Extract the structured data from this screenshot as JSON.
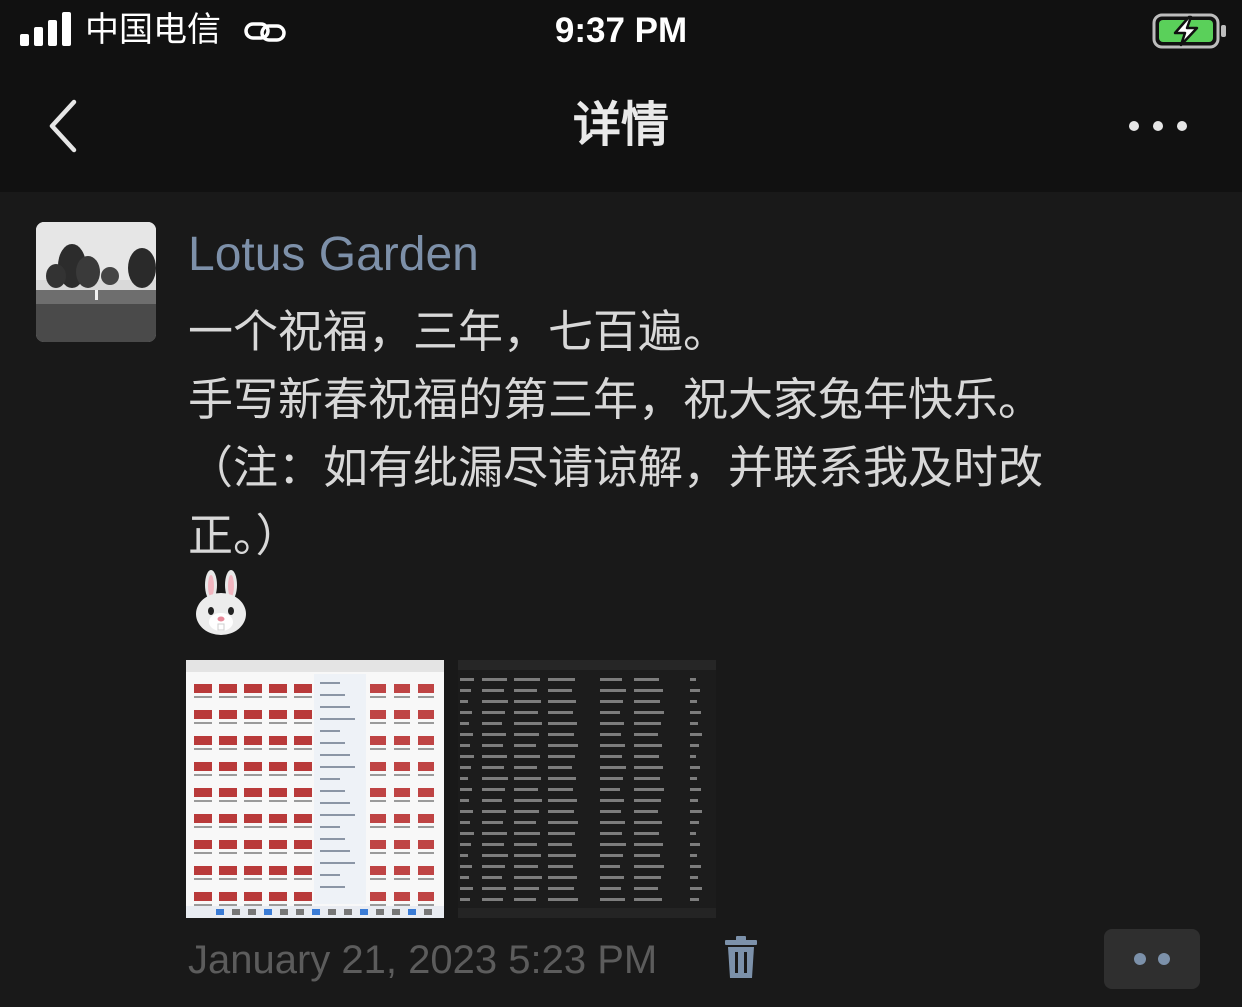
{
  "status_bar": {
    "carrier": "中国电信",
    "time": "9:37 PM",
    "battery_charging": true,
    "battery_color": "#5ad05a",
    "signal_icon": "signal-bars-icon",
    "link_icon": "link-icon"
  },
  "navbar": {
    "title": "详情",
    "back_icon": "chevron-left-icon",
    "more_icon": "more-horizontal-icon"
  },
  "post": {
    "author": "Lotus Garden",
    "lines": [
      "一个祝福，三年，七百遍。",
      "手写新春祝福的第三年，祝大家兔年快乐。",
      "（注：如有纰漏尽请谅解，并联系我及时改",
      "正。）"
    ],
    "emoji": "🐰",
    "timestamp": "January 21, 2023 5:23 PM",
    "delete_icon": "trash-icon",
    "action_icon": "more-dots-icon",
    "colors": {
      "author": "#7d90a9",
      "body": "#d8d8d8",
      "timestamp": "#5c5c5c"
    }
  }
}
